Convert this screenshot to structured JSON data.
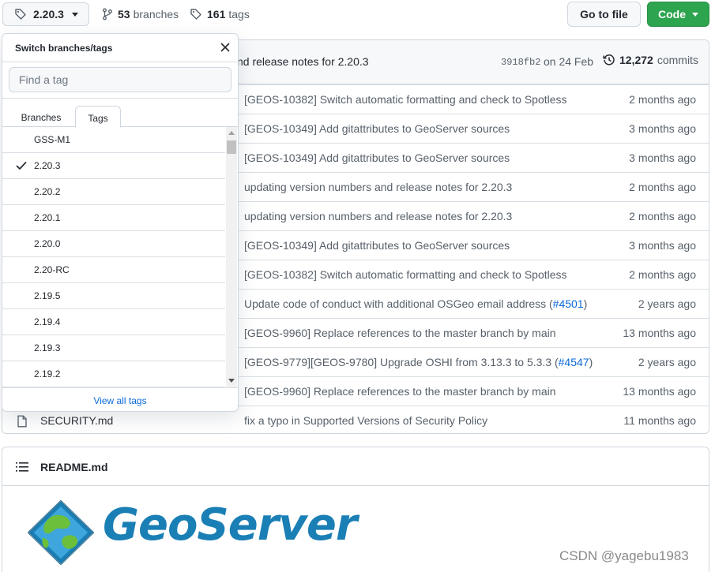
{
  "toolbar": {
    "branch_button_label": "2.20.3",
    "branches_count": "53",
    "branches_label": "branches",
    "tags_count": "161",
    "tags_label": "tags",
    "go_to_file_label": "Go to file",
    "code_button_label": "Code"
  },
  "latest_commit": {
    "message": "nd release notes for 2.20.3",
    "sha": "3918fb2",
    "date": "on 24 Feb",
    "commit_count": "12,272",
    "commits_label": "commits"
  },
  "files": [
    {
      "name": "",
      "message": "[GEOS-10382] Switch automatic formatting and check to Spotless",
      "link": "",
      "message_suffix": "",
      "age": "2 months ago"
    },
    {
      "name": "",
      "message": "[GEOS-10349] Add gitattributes to GeoServer sources",
      "link": "",
      "message_suffix": "",
      "age": "3 months ago"
    },
    {
      "name": "",
      "message": "[GEOS-10349] Add gitattributes to GeoServer sources",
      "link": "",
      "message_suffix": "",
      "age": "3 months ago"
    },
    {
      "name": "",
      "message": "updating version numbers and release notes for 2.20.3",
      "link": "",
      "message_suffix": "",
      "age": "2 months ago"
    },
    {
      "name": "",
      "message": "updating version numbers and release notes for 2.20.3",
      "link": "",
      "message_suffix": "",
      "age": "2 months ago"
    },
    {
      "name": "",
      "message": "[GEOS-10349] Add gitattributes to GeoServer sources",
      "link": "",
      "message_suffix": "",
      "age": "3 months ago"
    },
    {
      "name": "",
      "message": "[GEOS-10382] Switch automatic formatting and check to Spotless",
      "link": "",
      "message_suffix": "",
      "age": "2 months ago"
    },
    {
      "name": "",
      "message": "Update code of conduct with additional OSGeo email address (",
      "link": "#4501",
      "message_suffix": ")",
      "age": "2 years ago"
    },
    {
      "name": "",
      "message": "[GEOS-9960] Replace references to the master branch by main",
      "link": "",
      "message_suffix": "",
      "age": "13 months ago"
    },
    {
      "name": "",
      "message": "[GEOS-9779][GEOS-9780] Upgrade OSHI from 3.13.3 to 5.3.3 (",
      "link": "#4547",
      "message_suffix": ")",
      "age": "2 years ago"
    },
    {
      "name": "",
      "message": "[GEOS-9960] Replace references to the master branch by main",
      "link": "",
      "message_suffix": "",
      "age": "13 months ago"
    },
    {
      "name": "SECURITY.md",
      "message": "fix a typo in Supported Versions of Security Policy",
      "link": "",
      "message_suffix": "",
      "age": "11 months ago"
    }
  ],
  "dropdown": {
    "title": "Switch branches/tags",
    "filter_placeholder": "Find a tag",
    "tab_branches": "Branches",
    "tab_tags": "Tags",
    "tags": [
      {
        "label": "GSS-M1",
        "selected": false
      },
      {
        "label": "2.20.3",
        "selected": true
      },
      {
        "label": "2.20.2",
        "selected": false
      },
      {
        "label": "2.20.1",
        "selected": false
      },
      {
        "label": "2.20.0",
        "selected": false
      },
      {
        "label": "2.20-RC",
        "selected": false
      },
      {
        "label": "2.19.5",
        "selected": false
      },
      {
        "label": "2.19.4",
        "selected": false
      },
      {
        "label": "2.19.3",
        "selected": false
      },
      {
        "label": "2.19.2",
        "selected": false
      }
    ],
    "view_all_label": "View all tags"
  },
  "readme": {
    "title": "README.md",
    "logo_text": "GeoServer"
  },
  "watermark": "CSDN @yagebu1983",
  "colors": {
    "accent_green": "#2da44e",
    "link_blue": "#0969da",
    "geoserver_blue": "#1a7fb5",
    "geoserver_green": "#6bbf3a"
  }
}
